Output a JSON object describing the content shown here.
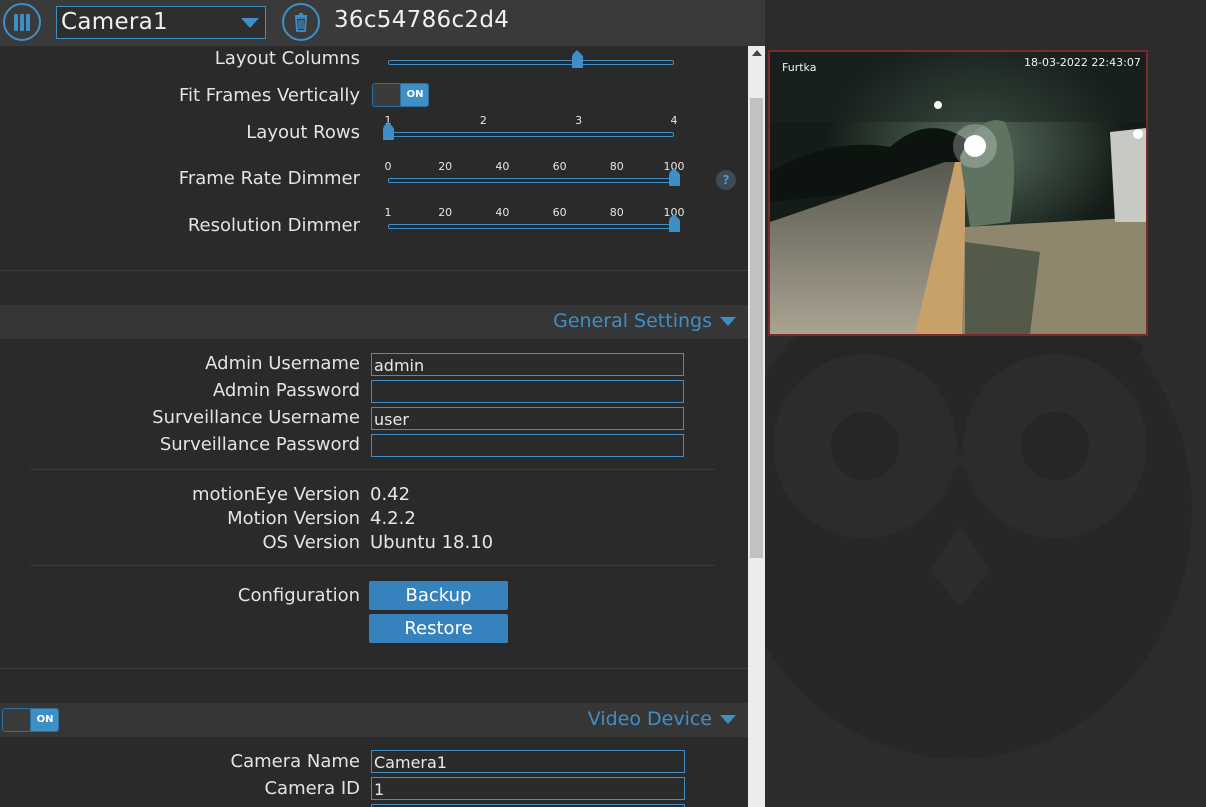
{
  "header": {
    "camera_select": "Camera1",
    "camera_id": "36c54786c2d4"
  },
  "preferences": {
    "layout_columns": {
      "label": "Layout Columns"
    },
    "fit_frames": {
      "label": "Fit Frames Vertically",
      "toggle": "ON"
    },
    "layout_rows": {
      "label": "Layout Rows",
      "ticks": [
        "1",
        "2",
        "3",
        "4"
      ],
      "value": 1
    },
    "frame_rate_dimmer": {
      "label": "Frame Rate Dimmer",
      "ticks": [
        "0",
        "20",
        "40",
        "60",
        "80",
        "100"
      ],
      "value": 100
    },
    "resolution_dimmer": {
      "label": "Resolution Dimmer",
      "ticks": [
        "1",
        "20",
        "40",
        "60",
        "80",
        "100"
      ],
      "value": 100
    },
    "help": "?"
  },
  "general_settings": {
    "title": "General Settings",
    "admin_username": {
      "label": "Admin Username",
      "value": "admin"
    },
    "admin_password": {
      "label": "Admin Password",
      "value": ""
    },
    "surveillance_username": {
      "label": "Surveillance Username",
      "value": "user"
    },
    "surveillance_password": {
      "label": "Surveillance Password",
      "value": ""
    },
    "versions": [
      {
        "label": "motionEye Version",
        "value": "0.42"
      },
      {
        "label": "Motion Version",
        "value": "4.2.2"
      },
      {
        "label": "OS Version",
        "value": "Ubuntu 18.10"
      }
    ],
    "configuration": {
      "label": "Configuration",
      "backup": "Backup",
      "restore": "Restore"
    }
  },
  "video_device": {
    "title": "Video Device",
    "toggle": "ON",
    "camera_name": {
      "label": "Camera Name",
      "value": "Camera1"
    },
    "camera_id": {
      "label": "Camera ID",
      "value": "1"
    }
  },
  "camera_frame": {
    "name": "Furtka",
    "timestamp": "18-03-2022 22:43:07"
  },
  "colors": {
    "accent": "#3f8fc7",
    "panel_bg": "#2a2a2a",
    "frame_border": "#7a2a2a"
  }
}
